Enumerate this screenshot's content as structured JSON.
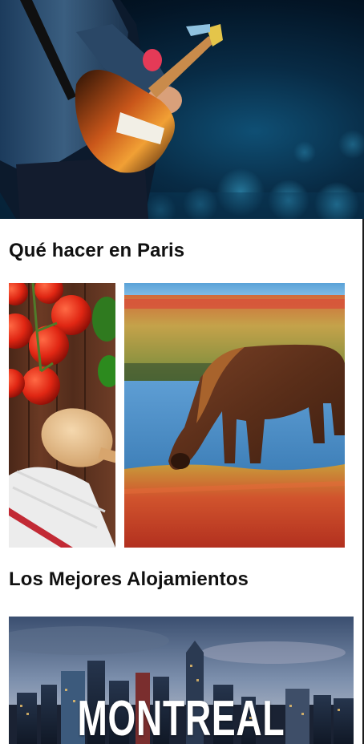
{
  "hero": {
    "image": "concert-guitarist-photo"
  },
  "sections": {
    "things_to_do": {
      "title": "Qué hacer en Paris",
      "cards": [
        {
          "image": "tomatoes-wooden-spoon-photo"
        },
        {
          "image": "horse-grazing-marsh-photo"
        }
      ]
    },
    "best_stays": {
      "title": "Los Mejores Alojamientos",
      "cards": [
        {
          "image": "montreal-skyline-photo",
          "label": "MONTREAL"
        }
      ]
    }
  },
  "colors": {
    "text": "#111111",
    "background": "#ffffff",
    "label": "#ffffff"
  }
}
